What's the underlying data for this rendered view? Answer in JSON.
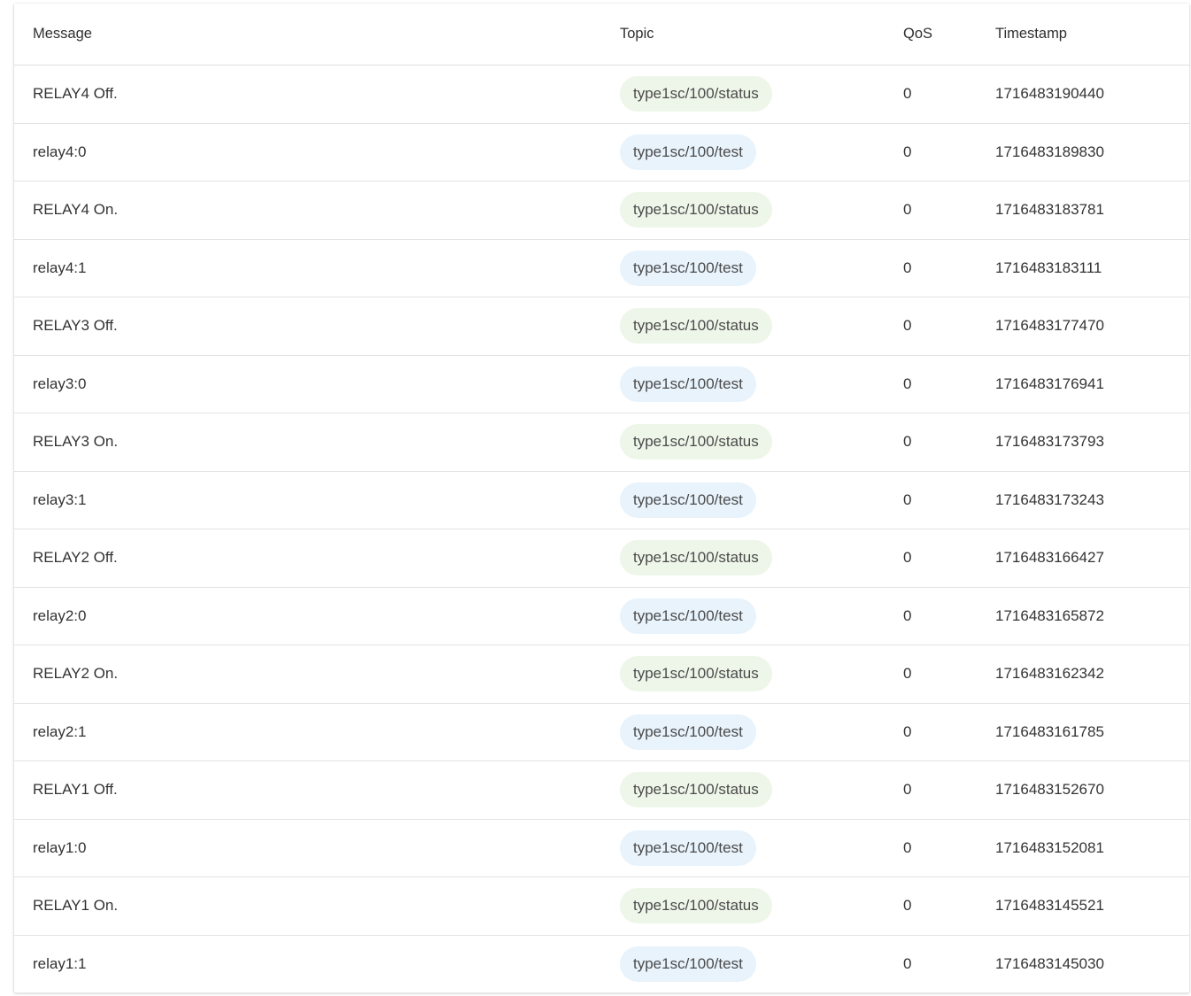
{
  "table": {
    "columns": [
      "Message",
      "Topic",
      "QoS",
      "Timestamp"
    ],
    "colors": {
      "status_chip_bg": "#eef6e9",
      "test_chip_bg": "#e8f3fc"
    },
    "rows": [
      {
        "message": "RELAY4 Off.",
        "topic": "type1sc/100/status",
        "qos": "0",
        "timestamp": "1716483190440"
      },
      {
        "message": "relay4:0",
        "topic": "type1sc/100/test",
        "qos": "0",
        "timestamp": "1716483189830"
      },
      {
        "message": "RELAY4 On.",
        "topic": "type1sc/100/status",
        "qos": "0",
        "timestamp": "1716483183781"
      },
      {
        "message": "relay4:1",
        "topic": "type1sc/100/test",
        "qos": "0",
        "timestamp": "1716483183111"
      },
      {
        "message": "RELAY3 Off.",
        "topic": "type1sc/100/status",
        "qos": "0",
        "timestamp": "1716483177470"
      },
      {
        "message": "relay3:0",
        "topic": "type1sc/100/test",
        "qos": "0",
        "timestamp": "1716483176941"
      },
      {
        "message": "RELAY3 On.",
        "topic": "type1sc/100/status",
        "qos": "0",
        "timestamp": "1716483173793"
      },
      {
        "message": "relay3:1",
        "topic": "type1sc/100/test",
        "qos": "0",
        "timestamp": "1716483173243"
      },
      {
        "message": "RELAY2 Off.",
        "topic": "type1sc/100/status",
        "qos": "0",
        "timestamp": "1716483166427"
      },
      {
        "message": "relay2:0",
        "topic": "type1sc/100/test",
        "qos": "0",
        "timestamp": "1716483165872"
      },
      {
        "message": "RELAY2 On.",
        "topic": "type1sc/100/status",
        "qos": "0",
        "timestamp": "1716483162342"
      },
      {
        "message": "relay2:1",
        "topic": "type1sc/100/test",
        "qos": "0",
        "timestamp": "1716483161785"
      },
      {
        "message": "RELAY1 Off.",
        "topic": "type1sc/100/status",
        "qos": "0",
        "timestamp": "1716483152670"
      },
      {
        "message": "relay1:0",
        "topic": "type1sc/100/test",
        "qos": "0",
        "timestamp": "1716483152081"
      },
      {
        "message": "RELAY1 On.",
        "topic": "type1sc/100/status",
        "qos": "0",
        "timestamp": "1716483145521"
      },
      {
        "message": "relay1:1",
        "topic": "type1sc/100/test",
        "qos": "0",
        "timestamp": "1716483145030"
      }
    ]
  }
}
